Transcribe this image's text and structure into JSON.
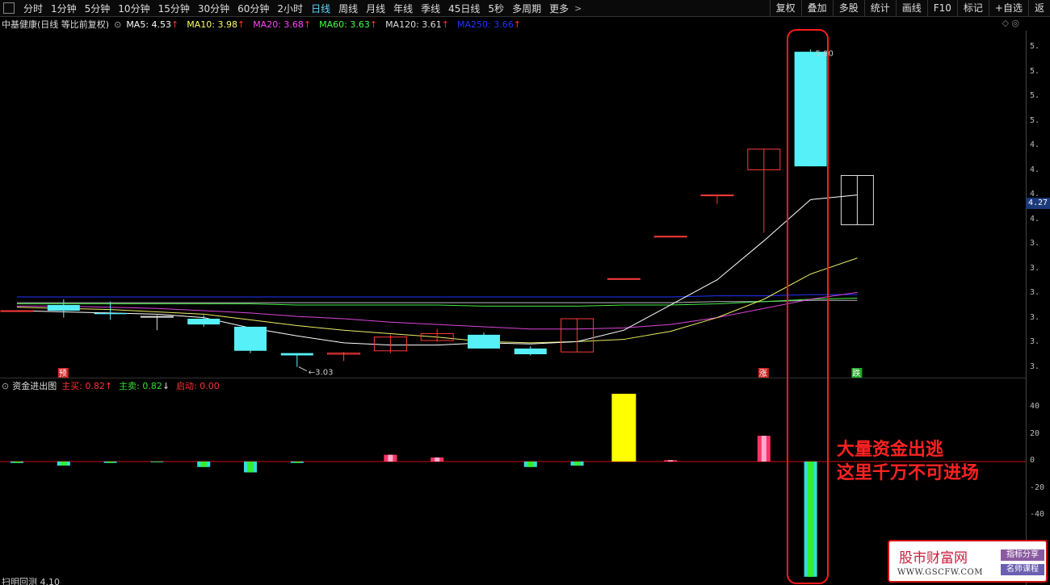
{
  "toolbar": {
    "periods": [
      "分时",
      "1分钟",
      "5分钟",
      "10分钟",
      "15分钟",
      "30分钟",
      "60分钟",
      "2小时",
      "日线",
      "周线",
      "月线",
      "年线",
      "季线",
      "45日线",
      "5秒",
      "多周期",
      "更多"
    ],
    "active_period": "日线",
    "more_arrow": ">",
    "right_tools": [
      "复权",
      "叠加",
      "多股",
      "统计",
      "画线",
      "F10",
      "标记",
      "+自选",
      "返"
    ]
  },
  "legend": {
    "stock": "中基健康(日线 等比前复权)",
    "ma": [
      {
        "label": "MA5: 4.53",
        "arrow": "↑",
        "color": "#ffffff"
      },
      {
        "label": "MA10: 3.98",
        "arrow": "↑",
        "color": "#ffff66"
      },
      {
        "label": "MA20: 3.68",
        "arrow": "↑",
        "color": "#ff44ff"
      },
      {
        "label": "MA60: 3.63",
        "arrow": "↑",
        "color": "#44ff44"
      },
      {
        "label": "MA120: 3.61",
        "arrow": "↑",
        "color": "#dddddd"
      },
      {
        "label": "MA250: 3.66",
        "arrow": "↑",
        "color": "#2233ff"
      }
    ],
    "switch_icon": "⊙"
  },
  "chart_ctrl": "◇ ◎",
  "price_tag": "4.27",
  "right_axis_ticks": [
    "5.",
    "5.",
    "5.",
    "5.",
    "4.",
    "4.",
    "4.",
    "4.",
    "3.",
    "3.",
    "3.",
    "3.",
    "3.",
    "3."
  ],
  "indicator": {
    "name": "资金进出图",
    "items": [
      {
        "label": "主买: 0.82",
        "arrow": "↑",
        "color": "#ff3333"
      },
      {
        "label": "主卖: 0.82",
        "arrow": "↓",
        "color": "#33dd33"
      },
      {
        "label": "启动: 0.00",
        "arrow": "",
        "color": "#ff3333"
      }
    ],
    "axis": [
      "40",
      "20",
      "0",
      "-20",
      "-40"
    ]
  },
  "chart_labels": {
    "low_label": "3.03",
    "high_label": "5.80",
    "marks": [
      "预",
      "涨",
      "跌"
    ]
  },
  "annotation": {
    "line1": "大量资金出逃",
    "line2": "这里千万不可进场"
  },
  "watermark": {
    "title": "股市财富网",
    "url": "WWW.GSCFW.COM",
    "tag1": "指标分享",
    "tag2": "名师课程"
  },
  "bottom_label": "扫明回测 4.10",
  "chart_data": [
    {
      "type": "candlestick",
      "title": "中基健康(日线 等比前复权)",
      "candles": [
        {
          "o": 3.52,
          "c": 3.52,
          "h": 3.52,
          "l": 3.52,
          "color": "up"
        },
        {
          "o": 3.52,
          "c": 3.57,
          "h": 3.62,
          "l": 3.46,
          "color": "cyan"
        },
        {
          "o": 3.5,
          "c": 3.49,
          "h": 3.6,
          "l": 3.44,
          "color": "cyan"
        },
        {
          "o": 3.47,
          "c": 3.47,
          "h": 3.48,
          "l": 3.35,
          "color": "flat"
        },
        {
          "o": 3.45,
          "c": 3.4,
          "h": 3.48,
          "l": 3.38,
          "color": "cyan"
        },
        {
          "o": 3.38,
          "c": 3.17,
          "h": 3.38,
          "l": 3.15,
          "color": "cyan"
        },
        {
          "o": 3.15,
          "c": 3.13,
          "h": 3.15,
          "l": 3.03,
          "color": "cyan"
        },
        {
          "o": 3.14,
          "c": 3.15,
          "h": 3.16,
          "l": 3.08,
          "color": "up"
        },
        {
          "o": 3.17,
          "c": 3.29,
          "h": 3.31,
          "l": 3.15,
          "color": "up"
        },
        {
          "o": 3.26,
          "c": 3.32,
          "h": 3.36,
          "l": 3.25,
          "color": "up"
        },
        {
          "o": 3.31,
          "c": 3.19,
          "h": 3.33,
          "l": 3.19,
          "color": "cyan"
        },
        {
          "o": 3.19,
          "c": 3.14,
          "h": 3.21,
          "l": 3.13,
          "color": "cyan"
        },
        {
          "o": 3.16,
          "c": 3.45,
          "h": 3.45,
          "l": 3.16,
          "color": "up"
        },
        {
          "o": 3.8,
          "c": 3.8,
          "h": 3.8,
          "l": 3.8,
          "color": "up"
        },
        {
          "o": 4.17,
          "c": 4.17,
          "h": 4.17,
          "l": 4.17,
          "color": "up"
        },
        {
          "o": 4.53,
          "c": 4.53,
          "h": 4.53,
          "l": 4.45,
          "color": "up"
        },
        {
          "o": 4.75,
          "c": 4.93,
          "h": 4.93,
          "l": 4.2,
          "color": "up"
        },
        {
          "o": 5.78,
          "c": 4.78,
          "h": 5.8,
          "l": 4.78,
          "color": "cyan"
        },
        {
          "o": 4.7,
          "c": 4.27,
          "h": 4.7,
          "l": 4.27,
          "color": "flat"
        }
      ],
      "ma": {
        "MA5": [
          3.52,
          3.51,
          3.5,
          3.49,
          3.46,
          3.37,
          3.3,
          3.24,
          3.22,
          3.22,
          3.24,
          3.23,
          3.25,
          3.35,
          3.57,
          3.79,
          4.13,
          4.49,
          4.53
        ],
        "MA10": [
          3.55,
          3.54,
          3.53,
          3.51,
          3.49,
          3.44,
          3.39,
          3.35,
          3.32,
          3.29,
          3.25,
          3.24,
          3.25,
          3.27,
          3.34,
          3.46,
          3.62,
          3.84,
          3.98
        ],
        "MA20": [
          3.56,
          3.56,
          3.55,
          3.54,
          3.52,
          3.5,
          3.47,
          3.45,
          3.42,
          3.4,
          3.38,
          3.36,
          3.36,
          3.37,
          3.4,
          3.46,
          3.54,
          3.62,
          3.68
        ],
        "MA60": [
          3.58,
          3.58,
          3.58,
          3.58,
          3.58,
          3.58,
          3.57,
          3.57,
          3.57,
          3.57,
          3.56,
          3.56,
          3.56,
          3.57,
          3.57,
          3.58,
          3.6,
          3.62,
          3.63
        ],
        "MA120": [
          3.59,
          3.59,
          3.59,
          3.59,
          3.59,
          3.59,
          3.59,
          3.59,
          3.59,
          3.59,
          3.59,
          3.59,
          3.59,
          3.59,
          3.59,
          3.6,
          3.6,
          3.61,
          3.61
        ],
        "MA250": [
          3.64,
          3.64,
          3.64,
          3.64,
          3.64,
          3.64,
          3.64,
          3.64,
          3.64,
          3.64,
          3.64,
          3.64,
          3.64,
          3.64,
          3.64,
          3.65,
          3.65,
          3.66,
          3.66
        ]
      },
      "ylim": [
        2.95,
        5.95
      ]
    },
    {
      "type": "bar",
      "title": "资金进出图",
      "values": [
        -1,
        -3,
        -1,
        -0.5,
        -4,
        -8,
        -1,
        0,
        5,
        3,
        0,
        -4,
        -3,
        50,
        1,
        0,
        19,
        -85,
        0
      ],
      "ylim": [
        -85,
        52
      ]
    }
  ]
}
